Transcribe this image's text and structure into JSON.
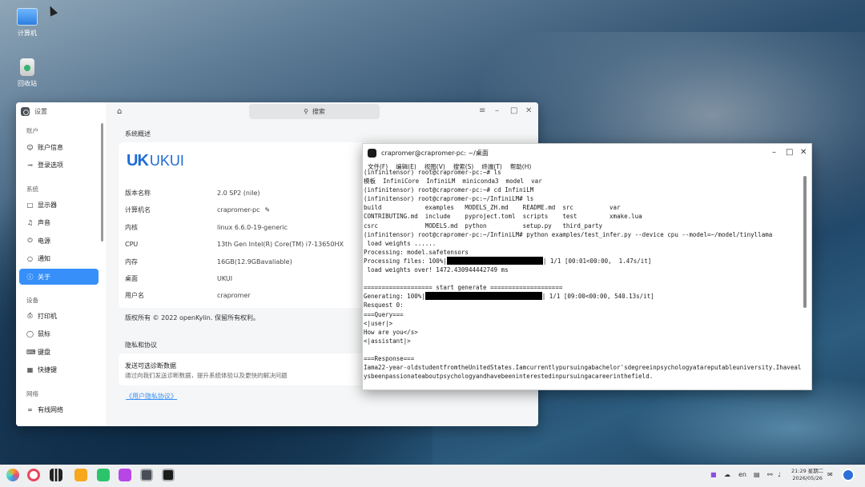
{
  "desktop": {
    "icons": [
      {
        "label": "计算机"
      },
      {
        "label": "回收站"
      }
    ]
  },
  "settings": {
    "app_title": "设置",
    "search_placeholder": "搜索",
    "sections": {
      "account": "账户",
      "system": "系统",
      "devices": "设备",
      "network": "网络"
    },
    "nav": {
      "account_info": "账户信息",
      "login_options": "登录选项",
      "display": "显示器",
      "sound": "声音",
      "power": "电源",
      "notify": "通知",
      "about": "关于",
      "printer": "打印机",
      "mouse": "鼠标",
      "keyboard": "键盘",
      "shortcut": "快捷键",
      "wired": "有线网络"
    },
    "overview_title": "系统概述",
    "logo_uk": "UK",
    "logo_ukui": "UKUI",
    "info": [
      {
        "key": "版本名称",
        "value": "2.0 SP2 (nile)"
      },
      {
        "key": "计算机名",
        "value": "crapromer-pc"
      },
      {
        "key": "内核",
        "value": "linux 6.6.0-19-generic"
      },
      {
        "key": "CPU",
        "value": "13th Gen Intel(R) Core(TM) i7-13650HX"
      },
      {
        "key": "内存",
        "value": "16GB(12.9GBavaliable)"
      },
      {
        "key": "桌面",
        "value": "UKUI"
      },
      {
        "key": "用户名",
        "value": "crapromer"
      }
    ],
    "copyright": "版权所有 © 2022 openKylin. 保留所有权利。",
    "privacy_title": "隐私和协议",
    "diag_title": "发送可选诊断数据",
    "diag_desc": "通过向我们发送诊断数据，提升系统体验以及更快的解决问题",
    "privacy_link": "《用户隐私协议》"
  },
  "terminal": {
    "title": "crapromer@crapromer-pc: ~/桌面",
    "menu": [
      "文件(F)",
      "编辑(E)",
      "视图(V)",
      "搜索(S)",
      "终端(T)",
      "帮助(H)"
    ],
    "lines": [
      {
        "pre": "(infinitensor) root@crapromer-pc:~# ls"
      },
      {
        "pre": "模板  InfiniCore  InfiniLM  miniconda3  model  var"
      },
      {
        "pre": "(infinitensor) root@crapromer-pc:~# cd InfiniLM"
      },
      {
        "pre": "(infinitensor) root@crapromer-pc:~/InfiniLM# ls"
      },
      {
        "pre": "build            examples   MODELS_ZH.md    README.md  src          var"
      },
      {
        "pre": "CONTRIBUTING.md  include    pyproject.toml  scripts    test         xmake.lua"
      },
      {
        "pre": "csrc             MODELS.md  python          setup.py   third_party"
      },
      {
        "pre": "(infinitensor) root@crapromer-pc:~/InfiniLM# python examples/test_infer.py --device cpu --model=~/model/tinyllama"
      },
      {
        "pre": " load weights ......"
      },
      {
        "pre": "Processing: model.safetensors"
      },
      {
        "pre": "Processing files: 100%|",
        "post": "| 1/1 [00:01<00:00,  1.47s/it]"
      },
      {
        "pre": " load weights over! 1472.430944442749 ms"
      },
      {
        "pre": ""
      },
      {
        "pre": "=================== start generate ===================="
      },
      {
        "pre": "Generating: 100%|",
        "post": "| 1/1 [09:00<00:00, 540.13s/it]"
      },
      {
        "pre": "Resquest 0:"
      },
      {
        "pre": "===Query==="
      },
      {
        "pre": "<|user|>"
      },
      {
        "pre": "How are you</s>"
      },
      {
        "pre": "<|assistant|>"
      },
      {
        "pre": ""
      },
      {
        "pre": "===Response==="
      },
      {
        "pre": "Iama22-year-oldstudentfromtheUnitedStates.Iamcurrentlypursuingabachelor'sdegreeinpsychologyatareputableuniversity.Ihavealwa"
      },
      {
        "pre": "ysbeenpassionateaboutpsychologyandhavebeeninterestedinpursuingacareerinthefield."
      }
    ]
  },
  "taskbar": {
    "lang": "en",
    "time": "21:29 星期二",
    "date": "2026/05/26"
  }
}
